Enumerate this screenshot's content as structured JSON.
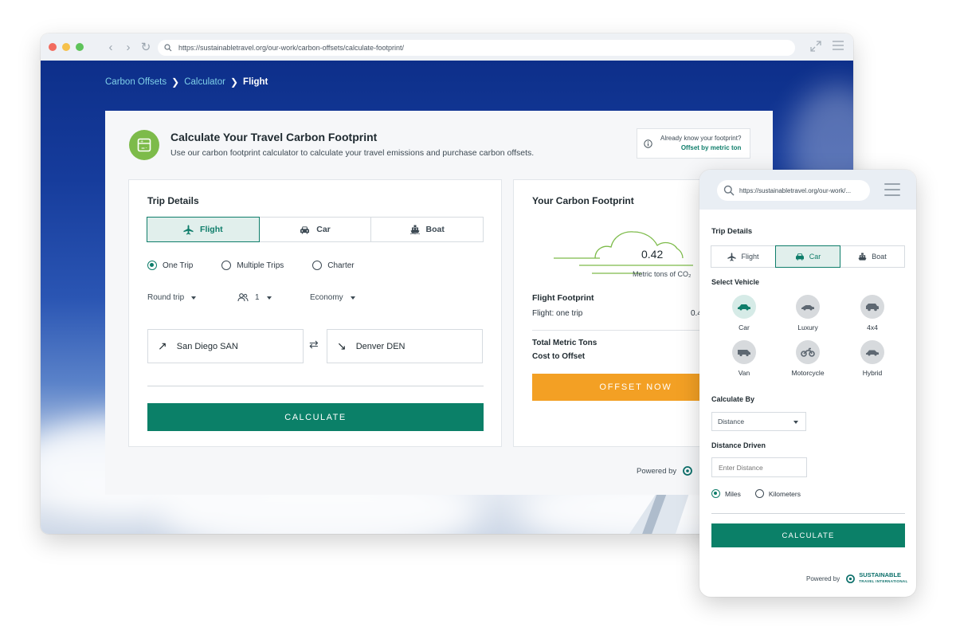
{
  "desktop": {
    "url": "https://sustainabletravel.org/our-work/carbon-offsets/calculate-footprint/",
    "breadcrumb": {
      "item1": "Carbon Offsets",
      "item2": "Calculator",
      "current": "Flight"
    },
    "header": {
      "title": "Calculate Your Travel Carbon Footprint",
      "subtitle": "Use our carbon footprint calculator to calculate your travel emissions and purchase carbon offsets.",
      "know_question": "Already know your footprint?",
      "know_link": "Offset by metric ton"
    },
    "trip": {
      "title": "Trip Details",
      "modes": [
        "Flight",
        "Car",
        "Boat"
      ],
      "active_mode": "Flight",
      "trip_types": [
        "One Trip",
        "Multiple Trips",
        "Charter"
      ],
      "selected_trip_type": "One Trip",
      "trip_direction": "Round trip",
      "passengers": "1",
      "cabin_class": "Economy",
      "origin": "San Diego SAN",
      "destination": "Denver DEN",
      "calculate_label": "CALCULATE"
    },
    "footprint": {
      "title": "Your Carbon Footprint",
      "value": "0.42",
      "unit": "Metric tons of CO₂",
      "section_title": "Flight Footprint",
      "line_label": "Flight: one trip",
      "line_value": "0.4",
      "total_label": "Total Metric Tons",
      "cost_label": "Cost to Offset",
      "offset_label": "OFFSET NOW"
    },
    "powered_by": "Powered by"
  },
  "mobile": {
    "url": "https://sustainabletravel.org/our-work/...",
    "trip_title": "Trip Details",
    "modes": [
      "Flight",
      "Car",
      "Boat"
    ],
    "active_mode": "Car",
    "vehicle_title": "Select Vehicle",
    "vehicles": [
      "Car",
      "Luxury",
      "4x4",
      "Van",
      "Motorcycle",
      "Hybrid"
    ],
    "selected_vehicle": "Car",
    "calc_by_title": "Calculate By",
    "calc_by_value": "Distance",
    "distance_title": "Distance Driven",
    "distance_placeholder": "Enter Distance",
    "units": [
      "Miles",
      "Kilometers"
    ],
    "selected_unit": "Miles",
    "calculate_label": "CALCULATE",
    "powered_by": "Powered by",
    "brand_name": "SUSTAINABLE",
    "brand_sub": "TRAVEL INTERNATIONAL"
  },
  "colors": {
    "accent": "#0b8068",
    "offset": "#f3a024",
    "icon_green": "#7dbb4a",
    "breadcrumb_link": "#7fd0e8"
  }
}
